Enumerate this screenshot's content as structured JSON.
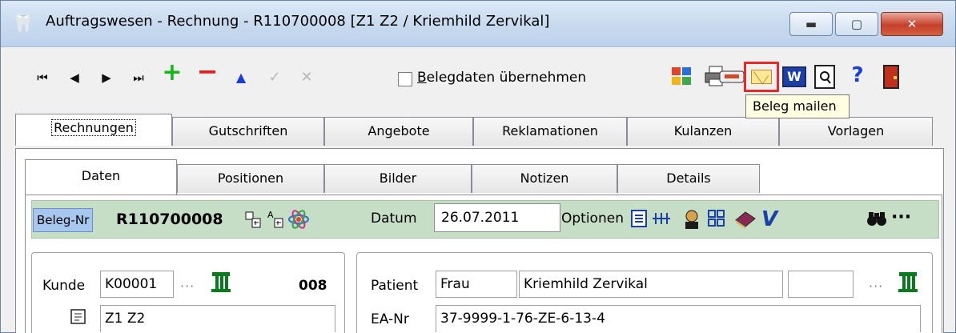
{
  "window": {
    "title": "Auftragswesen - Rechnung - R110700008 [Z1 Z2 / Kriemhild Zervikal]",
    "app_icon": "tooth-icon",
    "controls": {
      "minimize": "▬",
      "maximize": "▢",
      "close": "✕"
    }
  },
  "toolbar": {
    "nav": {
      "first": "⏮",
      "prev": "◀",
      "next": "▶",
      "last": "⏭"
    },
    "add": "+",
    "remove": "−",
    "up": "▲",
    "confirm": "✓",
    "cancel": "✕",
    "checkbox_label_underline": "B",
    "checkbox_label_rest": "elegdaten übernehmen",
    "checkbox_checked": false,
    "icons": [
      "grid-icon",
      "printer-icon",
      "card-icon",
      "mail-icon",
      "word-icon",
      "preview-icon",
      "help-icon",
      "exit-icon"
    ],
    "help_glyph": "?",
    "word_glyph": "W",
    "tooltip": "Beleg mailen"
  },
  "tabs_main": [
    "Rechnungen",
    "Gutschriften",
    "Angebote",
    "Reklamationen",
    "Kulanzen",
    "Vorlagen"
  ],
  "tabs_main_active": "Rechnungen",
  "tabs_sub": [
    "Daten",
    "Positionen",
    "Bilder",
    "Notizen",
    "Details"
  ],
  "tabs_sub_active": "Daten",
  "beleg": {
    "label": "Beleg-Nr",
    "number": "R110700008",
    "datum_label": "Datum",
    "datum": "26.07.2011",
    "optionen_label": "Optionen",
    "more": "···"
  },
  "kunde": {
    "label": "Kunde",
    "id": "K00001",
    "more": "···",
    "code": "008",
    "note": "Z1 Z2"
  },
  "patient": {
    "label": "Patient",
    "salutation": "Frau",
    "name": "Kriemhild Zervikal",
    "extra": "",
    "more": "···",
    "ea_label": "EA-Nr",
    "ea_nr": "37-9999-1-76-ZE-6-13-4"
  },
  "colors": {
    "accent_green": "#16b51a",
    "accent_red": "#e02020",
    "highlight": "#e62a2a",
    "green_bar": "#c6ddc6"
  }
}
